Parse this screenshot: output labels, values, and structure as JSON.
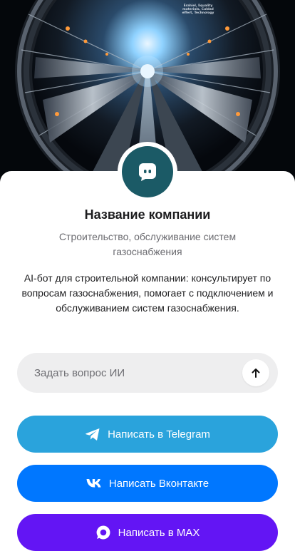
{
  "hero": {
    "caption": "Erahiel, liquality materials, Culdad effert, Technology",
    "image_icon": "industrial-pipeline-tunnel-image"
  },
  "company": {
    "avatar_icon": "chat-bot-icon",
    "name": "Название компании",
    "subtitle": "Строительство, обслуживание систем газоснабжения",
    "description": "AI-бот для строительной компании: консультирует по вопросам газоснабжения, помогает с подключением и обслуживанием систем газоснабжения."
  },
  "search": {
    "placeholder": "Задать вопрос ИИ",
    "value": "",
    "send_icon": "arrow-up-icon"
  },
  "buttons": [
    {
      "label": "Написать в Telegram",
      "icon": "telegram-icon",
      "color": "#2aa3dc"
    },
    {
      "label": "Написать Вконтакте",
      "icon": "vk-icon",
      "color": "#0077ff"
    },
    {
      "label": "Написать в MAX",
      "icon": "max-icon",
      "color": "#6315f4"
    }
  ],
  "colors": {
    "avatar_bg": "#1b5a66",
    "search_bg": "#eeeeef"
  }
}
